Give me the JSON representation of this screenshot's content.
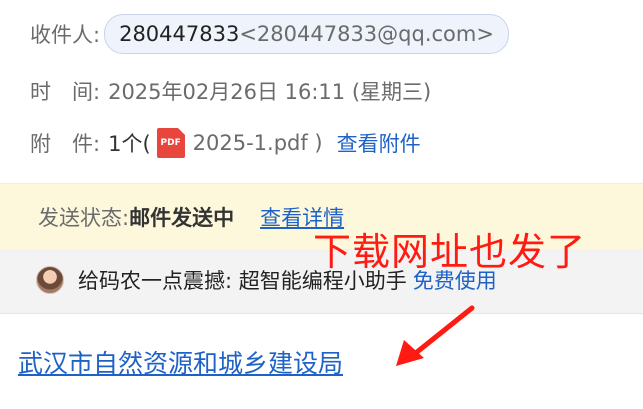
{
  "recipient": {
    "label": "收件人:",
    "name": "280447833",
    "address": "<280447833@qq.com>"
  },
  "time": {
    "label": "时　间:",
    "value": "2025年02月26日 16:11 (星期三)"
  },
  "attachment": {
    "label": "附　件:",
    "count": "1个(",
    "icon": "pdf-icon",
    "icon_text": "PDF",
    "filename": "2025-1.pdf )",
    "view_link": "查看附件"
  },
  "status": {
    "label": "发送状态:",
    "value": "邮件发送中",
    "details_link": "查看详情"
  },
  "promo": {
    "text": "给码农一点震撼: 超智能编程小助手",
    "link": "免费使用"
  },
  "annotation": {
    "text": "下载网址也发了",
    "color": "#ff1a12"
  },
  "body_link": "武汉市自然资源和城乡建设局",
  "colors": {
    "link": "#1e62c8",
    "status_bg": "#fdf8dc",
    "promo_bg": "#f3f3f3",
    "pill_bg": "#eef3fc"
  }
}
